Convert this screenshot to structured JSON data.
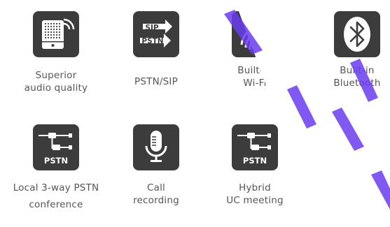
{
  "features": [
    {
      "id": "audio",
      "icon": "speaker-wifi-icon",
      "line1": "Superior",
      "line2": "audio quality"
    },
    {
      "id": "pstn-sip",
      "icon": "pstn-sip-arrows-icon",
      "icon_text": [
        "SIP",
        "PSTN"
      ],
      "line1": "PSTN/SIP",
      "line2": ""
    },
    {
      "id": "wifi",
      "icon": "wifi-icon",
      "line1": "Built-in",
      "line2": "Wi-Fi"
    },
    {
      "id": "bluetooth",
      "icon": "bluetooth-icon",
      "line1": "Built-in",
      "line2": "Bluetooth"
    },
    {
      "id": "local-pstn",
      "icon": "pstn-network-icon",
      "icon_text": "PSTN",
      "line1": "Local 3-way PSTN",
      "line2": "conference"
    },
    {
      "id": "recording",
      "icon": "microphone-icon",
      "line1": "Call",
      "line2": "recording"
    },
    {
      "id": "hybrid-uc",
      "icon": "pstn-network-icon",
      "icon_text": "PSTN",
      "line1": "Hybrid",
      "line2": "UC meeting"
    }
  ],
  "colors": {
    "tile": "#3c3c3c",
    "text": "#555555",
    "watermark": "#6a3cf0"
  }
}
